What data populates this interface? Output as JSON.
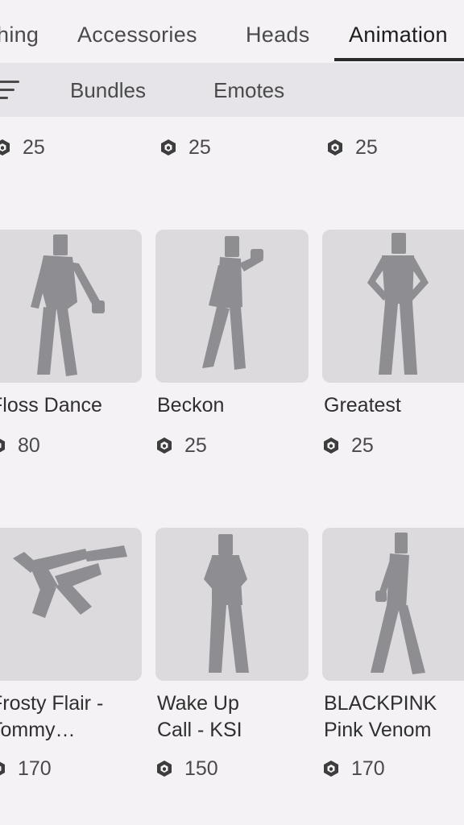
{
  "category_tabs": [
    {
      "label": "hing",
      "active": false
    },
    {
      "label": "Accessories",
      "active": false
    },
    {
      "label": "Heads",
      "active": false
    },
    {
      "label": "Animation",
      "active": true
    }
  ],
  "sub_tabs": [
    {
      "label": "Bundles"
    },
    {
      "label": "Emotes"
    }
  ],
  "colors": {
    "background": "#f4f2f5",
    "sub_bar": "#e6e4e8",
    "thumbnail": "#dcdadd",
    "figure": "#8e8d91",
    "text": "#2f2f2f"
  },
  "currency_icon": "robux-icon",
  "top_row_prices": [
    "25",
    "25",
    "25"
  ],
  "items": [
    {
      "name": "Floss Dance",
      "price": "80"
    },
    {
      "name": "Beckon",
      "price": "25"
    },
    {
      "name": "Greatest",
      "price": "25"
    },
    {
      "name": "Frosty Flair -\nTommy…",
      "price": "170"
    },
    {
      "name": "Wake Up\nCall - KSI",
      "price": "150"
    },
    {
      "name": "BLACKPINK\nPink Venom",
      "price": "170"
    }
  ]
}
